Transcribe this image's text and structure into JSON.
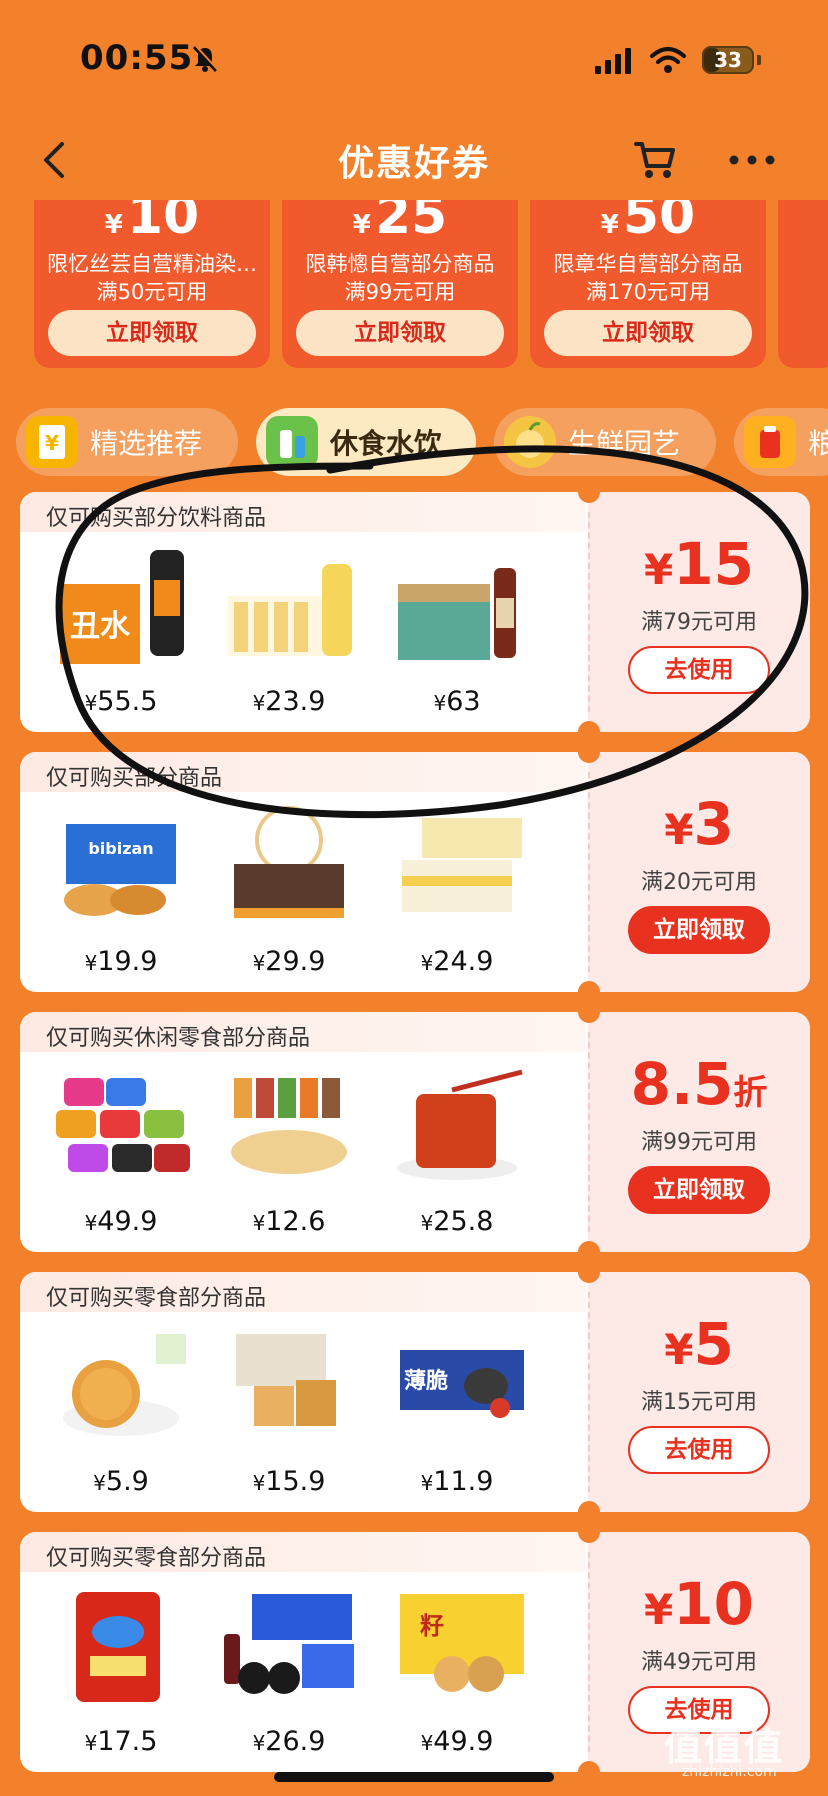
{
  "status_bar": {
    "time": "00:55",
    "battery": "33",
    "battery_level": 0.33
  },
  "nav": {
    "title": "优惠好券",
    "icons": [
      "back-arrow-icon",
      "cart-icon",
      "more-icon"
    ]
  },
  "top_coupons": [
    {
      "yen": "¥",
      "amount": "10",
      "title": "限忆丝芸自营精油染…",
      "condition": "满50元可用",
      "button": "立即领取"
    },
    {
      "yen": "¥",
      "amount": "25",
      "title": "限韩憁自营部分商品",
      "condition": "满99元可用",
      "button": "立即领取"
    },
    {
      "yen": "¥",
      "amount": "50",
      "title": "限章华自营部分商品",
      "condition": "满170元可用",
      "button": "立即领取"
    }
  ],
  "tabs": [
    {
      "label": "精选推荐",
      "active": false
    },
    {
      "label": "休食水饮",
      "active": true
    },
    {
      "label": "生鲜园艺",
      "active": false
    },
    {
      "label": "粮",
      "active": false
    }
  ],
  "cards": [
    {
      "scope": "仅可购买部分饮料商品",
      "prefix": "¥",
      "value": "15",
      "unit": "",
      "condition": "满79元可用",
      "button": "去使用",
      "button_type": "use",
      "products": [
        {
          "yen": "¥",
          "price": "55.5"
        },
        {
          "yen": "¥",
          "price": "23.9"
        },
        {
          "yen": "¥",
          "price": "63"
        }
      ]
    },
    {
      "scope": "仅可购买部分商品",
      "prefix": "¥",
      "value": "3",
      "unit": "",
      "condition": "满20元可用",
      "button": "立即领取",
      "button_type": "get",
      "products": [
        {
          "yen": "¥",
          "price": "19.9"
        },
        {
          "yen": "¥",
          "price": "29.9"
        },
        {
          "yen": "¥",
          "price": "24.9"
        }
      ]
    },
    {
      "scope": "仅可购买休闲零食部分商品",
      "prefix": "",
      "value": "8.5",
      "unit": "折",
      "condition": "满99元可用",
      "button": "立即领取",
      "button_type": "get",
      "products": [
        {
          "yen": "¥",
          "price": "49.9"
        },
        {
          "yen": "¥",
          "price": "12.6"
        },
        {
          "yen": "¥",
          "price": "25.8"
        }
      ]
    },
    {
      "scope": "仅可购买零食部分商品",
      "prefix": "¥",
      "value": "5",
      "unit": "",
      "condition": "满15元可用",
      "button": "去使用",
      "button_type": "use",
      "products": [
        {
          "yen": "¥",
          "price": "5.9"
        },
        {
          "yen": "¥",
          "price": "15.9"
        },
        {
          "yen": "¥",
          "price": "11.9"
        }
      ]
    },
    {
      "scope": "仅可购买零食部分商品",
      "prefix": "¥",
      "value": "10",
      "unit": "",
      "condition": "满49元可用",
      "button": "去使用",
      "button_type": "use",
      "products": [
        {
          "yen": "¥",
          "price": "17.5"
        },
        {
          "yen": "¥",
          "price": "26.9"
        },
        {
          "yen": "¥",
          "price": "49.9"
        }
      ]
    }
  ],
  "watermark": {
    "main": "值值值",
    "sub": "zhizhizhi.com"
  },
  "colors": {
    "background": "#f3802b",
    "accent_red": "#e8321f",
    "coupon_orange": "#f05a2c",
    "tab_active": "#fde9c2"
  }
}
